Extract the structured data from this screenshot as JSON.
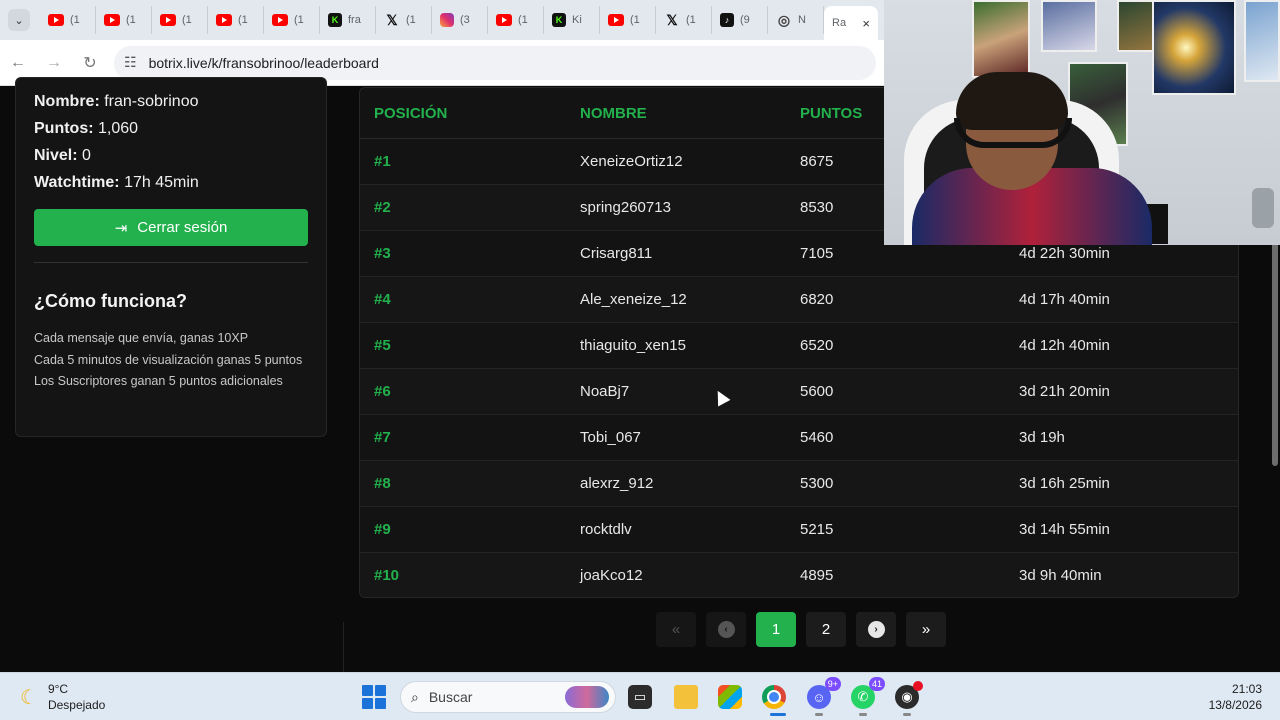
{
  "browser": {
    "tabs": [
      {
        "icon": "youtube",
        "label": "(1"
      },
      {
        "icon": "youtube",
        "label": "(1"
      },
      {
        "icon": "youtube",
        "label": "(1"
      },
      {
        "icon": "youtube",
        "label": "(1"
      },
      {
        "icon": "youtube",
        "label": "(1"
      },
      {
        "icon": "kick",
        "label": "fra"
      },
      {
        "icon": "x",
        "label": "(1"
      },
      {
        "icon": "instagram",
        "label": "(3"
      },
      {
        "icon": "youtube",
        "label": "(1"
      },
      {
        "icon": "kick",
        "label": "Ki"
      },
      {
        "icon": "youtube",
        "label": "(1"
      },
      {
        "icon": "x",
        "label": "(1"
      },
      {
        "icon": "tiktok",
        "label": "(9"
      },
      {
        "icon": "github",
        "label": "N"
      }
    ],
    "active_tab": {
      "label": "Ra",
      "close": "×"
    },
    "url": "botrix.live/k/fransobrinoo/leaderboard"
  },
  "sidebar": {
    "user": [
      {
        "label": "Nombre:",
        "value": " fran-sobrinoo"
      },
      {
        "label": "Puntos:",
        "value": " 1,060"
      },
      {
        "label": "Nivel:",
        "value": " 0"
      },
      {
        "label": "Watchtime:",
        "value": " 17h 45min"
      }
    ],
    "logout_label": "Cerrar sesión",
    "howto_title": "¿Cómo funciona?",
    "howto_items": [
      "Cada mensaje que envía, ganas 10XP",
      "Cada 5 minutos de visualización ganas 5 puntos",
      "Los Suscriptores ganan 5 puntos adicionales"
    ]
  },
  "leaderboard": {
    "headers": [
      "POSICIÓN",
      "NOMBRE",
      "PUNTOS",
      ""
    ],
    "rows": [
      {
        "pos": "#1",
        "name": "XeneizeOrtiz12",
        "points": "8675",
        "watchtime": ""
      },
      {
        "pos": "#2",
        "name": "spring260713",
        "points": "8530",
        "watchtime": ""
      },
      {
        "pos": "#3",
        "name": "Crisarg811",
        "points": "7105",
        "watchtime": "4d 22h 30min"
      },
      {
        "pos": "#4",
        "name": "Ale_xeneize_12",
        "points": "6820",
        "watchtime": "4d 17h 40min"
      },
      {
        "pos": "#5",
        "name": "thiaguito_xen15",
        "points": "6520",
        "watchtime": "4d 12h 40min"
      },
      {
        "pos": "#6",
        "name": "NoaBj7",
        "points": "5600",
        "watchtime": "3d 21h 20min"
      },
      {
        "pos": "#7",
        "name": "Tobi_067",
        "points": "5460",
        "watchtime": "3d 19h"
      },
      {
        "pos": "#8",
        "name": "alexrz_912",
        "points": "5300",
        "watchtime": "3d 16h 25min"
      },
      {
        "pos": "#9",
        "name": "rocktdlv",
        "points": "5215",
        "watchtime": "3d 14h 55min"
      },
      {
        "pos": "#10",
        "name": "joaKco12",
        "points": "4895",
        "watchtime": "3d 9h 40min"
      }
    ]
  },
  "pagination": {
    "first": "«",
    "prev": "‹",
    "pages": [
      "1",
      "2"
    ],
    "current": "1",
    "next": "›",
    "last": "»"
  },
  "taskbar": {
    "weather_temp": "9°C",
    "weather_desc": "Despejado",
    "search_placeholder": "Buscar",
    "discord_badge": "9+",
    "whatsapp_badge": "41",
    "time": "21:03",
    "date": "13/8/2026"
  },
  "colors": {
    "accent": "#22b14c",
    "page_bg": "#0b0b0b"
  }
}
